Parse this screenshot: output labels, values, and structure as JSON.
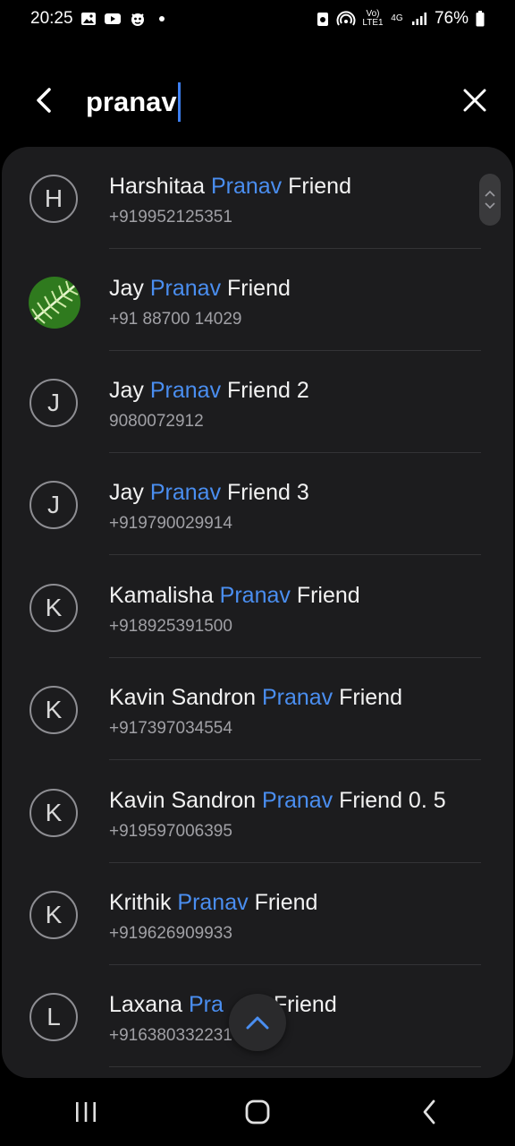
{
  "status_bar": {
    "time": "20:25",
    "battery": "76%",
    "network": "4G",
    "volte": "Vo) LTE1"
  },
  "search": {
    "query": "pranav",
    "back_icon": "arrow-back-icon",
    "clear_icon": "close-icon"
  },
  "contacts": [
    {
      "initial": "H",
      "name_pre": "Harshitaa ",
      "match": "Pranav",
      "name_post": " Friend",
      "phone": "+919952125351"
    },
    {
      "initial": "",
      "name_pre": "Jay ",
      "match": "Pranav",
      "name_post": " Friend",
      "phone": "+91 88700 14029"
    },
    {
      "initial": "J",
      "name_pre": "Jay ",
      "match": "Pranav",
      "name_post": " Friend 2",
      "phone": "9080072912"
    },
    {
      "initial": "J",
      "name_pre": "Jay ",
      "match": "Pranav",
      "name_post": " Friend 3",
      "phone": "+919790029914"
    },
    {
      "initial": "K",
      "name_pre": "Kamalisha ",
      "match": "Pranav",
      "name_post": " Friend",
      "phone": "+918925391500"
    },
    {
      "initial": "K",
      "name_pre": "Kavin Sandron ",
      "match": "Pranav",
      "name_post": " Friend",
      "phone": "+917397034554"
    },
    {
      "initial": "K",
      "name_pre": "Kavin Sandron ",
      "match": "Pranav",
      "name_post": " Friend 0. 5",
      "phone": "+919597006395"
    },
    {
      "initial": "K",
      "name_pre": "Krithik ",
      "match": "Pranav",
      "name_post": " Friend",
      "phone": "+919626909933"
    },
    {
      "initial": "L",
      "name_pre": "Laxana ",
      "match": "Pra",
      "name_post": "",
      "name_tail": "Friend",
      "phone": "+916380332231"
    }
  ],
  "colors": {
    "highlight": "#4a8ef0",
    "panel": "#1c1c1e",
    "caret": "#3d7ff0"
  },
  "nav": {
    "recents_icon": "recents-icon",
    "home_icon": "home-icon",
    "back_icon": "back-icon"
  }
}
